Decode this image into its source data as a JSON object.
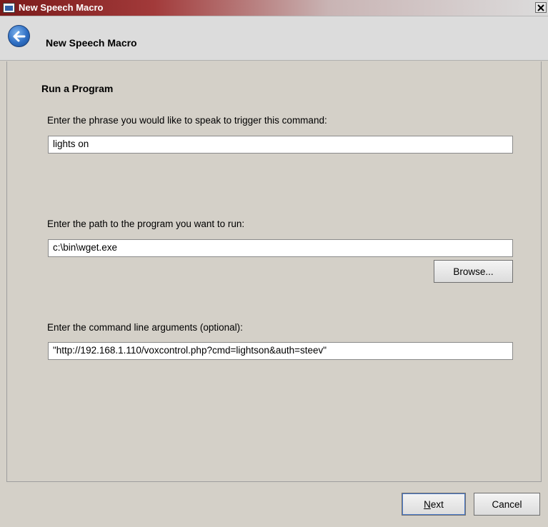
{
  "window": {
    "title": "New Speech Macro",
    "icons": {
      "app": "window-app-icon",
      "close": "close-icon"
    }
  },
  "header": {
    "title": "New Speech Macro",
    "back_icon": "back-arrow-icon"
  },
  "main": {
    "section_title": "Run a Program",
    "phrase": {
      "label": "Enter the phrase you would like to speak to trigger this command:",
      "value": "lights on"
    },
    "program_path": {
      "label": "Enter the path to the program you want to run:",
      "value": "c:\\bin\\wget.exe",
      "browse_label": "Browse..."
    },
    "arguments": {
      "label": "Enter the command line arguments (optional):",
      "value": "\"http://192.168.1.110/voxcontrol.php?cmd=lightson&auth=steev\""
    }
  },
  "footer": {
    "next_label_mnemonic": "N",
    "next_label_rest": "ext",
    "cancel_label": "Cancel"
  }
}
